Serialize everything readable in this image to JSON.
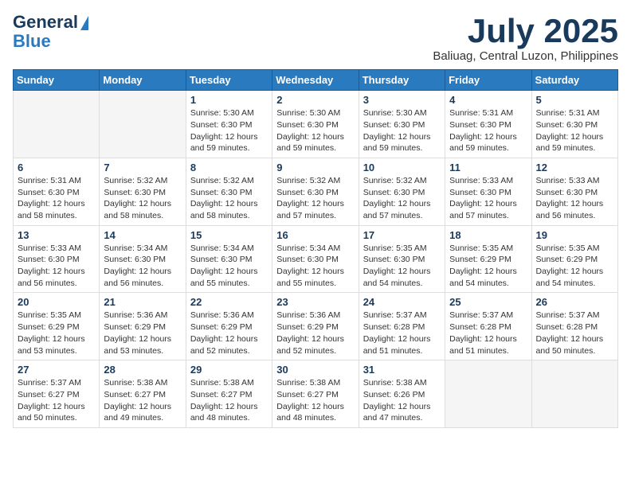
{
  "header": {
    "logo_line1": "General",
    "logo_line2": "Blue",
    "month_title": "July 2025",
    "location": "Baliuag, Central Luzon, Philippines"
  },
  "weekdays": [
    "Sunday",
    "Monday",
    "Tuesday",
    "Wednesday",
    "Thursday",
    "Friday",
    "Saturday"
  ],
  "weeks": [
    [
      {
        "day": "",
        "empty": true
      },
      {
        "day": "",
        "empty": true
      },
      {
        "day": "1",
        "sunrise": "5:30 AM",
        "sunset": "6:30 PM",
        "daylight": "12 hours and 59 minutes."
      },
      {
        "day": "2",
        "sunrise": "5:30 AM",
        "sunset": "6:30 PM",
        "daylight": "12 hours and 59 minutes."
      },
      {
        "day": "3",
        "sunrise": "5:30 AM",
        "sunset": "6:30 PM",
        "daylight": "12 hours and 59 minutes."
      },
      {
        "day": "4",
        "sunrise": "5:31 AM",
        "sunset": "6:30 PM",
        "daylight": "12 hours and 59 minutes."
      },
      {
        "day": "5",
        "sunrise": "5:31 AM",
        "sunset": "6:30 PM",
        "daylight": "12 hours and 59 minutes."
      }
    ],
    [
      {
        "day": "6",
        "sunrise": "5:31 AM",
        "sunset": "6:30 PM",
        "daylight": "12 hours and 58 minutes."
      },
      {
        "day": "7",
        "sunrise": "5:32 AM",
        "sunset": "6:30 PM",
        "daylight": "12 hours and 58 minutes."
      },
      {
        "day": "8",
        "sunrise": "5:32 AM",
        "sunset": "6:30 PM",
        "daylight": "12 hours and 58 minutes."
      },
      {
        "day": "9",
        "sunrise": "5:32 AM",
        "sunset": "6:30 PM",
        "daylight": "12 hours and 57 minutes."
      },
      {
        "day": "10",
        "sunrise": "5:32 AM",
        "sunset": "6:30 PM",
        "daylight": "12 hours and 57 minutes."
      },
      {
        "day": "11",
        "sunrise": "5:33 AM",
        "sunset": "6:30 PM",
        "daylight": "12 hours and 57 minutes."
      },
      {
        "day": "12",
        "sunrise": "5:33 AM",
        "sunset": "6:30 PM",
        "daylight": "12 hours and 56 minutes."
      }
    ],
    [
      {
        "day": "13",
        "sunrise": "5:33 AM",
        "sunset": "6:30 PM",
        "daylight": "12 hours and 56 minutes."
      },
      {
        "day": "14",
        "sunrise": "5:34 AM",
        "sunset": "6:30 PM",
        "daylight": "12 hours and 56 minutes."
      },
      {
        "day": "15",
        "sunrise": "5:34 AM",
        "sunset": "6:30 PM",
        "daylight": "12 hours and 55 minutes."
      },
      {
        "day": "16",
        "sunrise": "5:34 AM",
        "sunset": "6:30 PM",
        "daylight": "12 hours and 55 minutes."
      },
      {
        "day": "17",
        "sunrise": "5:35 AM",
        "sunset": "6:30 PM",
        "daylight": "12 hours and 54 minutes."
      },
      {
        "day": "18",
        "sunrise": "5:35 AM",
        "sunset": "6:29 PM",
        "daylight": "12 hours and 54 minutes."
      },
      {
        "day": "19",
        "sunrise": "5:35 AM",
        "sunset": "6:29 PM",
        "daylight": "12 hours and 54 minutes."
      }
    ],
    [
      {
        "day": "20",
        "sunrise": "5:35 AM",
        "sunset": "6:29 PM",
        "daylight": "12 hours and 53 minutes."
      },
      {
        "day": "21",
        "sunrise": "5:36 AM",
        "sunset": "6:29 PM",
        "daylight": "12 hours and 53 minutes."
      },
      {
        "day": "22",
        "sunrise": "5:36 AM",
        "sunset": "6:29 PM",
        "daylight": "12 hours and 52 minutes."
      },
      {
        "day": "23",
        "sunrise": "5:36 AM",
        "sunset": "6:29 PM",
        "daylight": "12 hours and 52 minutes."
      },
      {
        "day": "24",
        "sunrise": "5:37 AM",
        "sunset": "6:28 PM",
        "daylight": "12 hours and 51 minutes."
      },
      {
        "day": "25",
        "sunrise": "5:37 AM",
        "sunset": "6:28 PM",
        "daylight": "12 hours and 51 minutes."
      },
      {
        "day": "26",
        "sunrise": "5:37 AM",
        "sunset": "6:28 PM",
        "daylight": "12 hours and 50 minutes."
      }
    ],
    [
      {
        "day": "27",
        "sunrise": "5:37 AM",
        "sunset": "6:27 PM",
        "daylight": "12 hours and 50 minutes."
      },
      {
        "day": "28",
        "sunrise": "5:38 AM",
        "sunset": "6:27 PM",
        "daylight": "12 hours and 49 minutes."
      },
      {
        "day": "29",
        "sunrise": "5:38 AM",
        "sunset": "6:27 PM",
        "daylight": "12 hours and 48 minutes."
      },
      {
        "day": "30",
        "sunrise": "5:38 AM",
        "sunset": "6:27 PM",
        "daylight": "12 hours and 48 minutes."
      },
      {
        "day": "31",
        "sunrise": "5:38 AM",
        "sunset": "6:26 PM",
        "daylight": "12 hours and 47 minutes."
      },
      {
        "day": "",
        "empty": true
      },
      {
        "day": "",
        "empty": true
      }
    ]
  ]
}
